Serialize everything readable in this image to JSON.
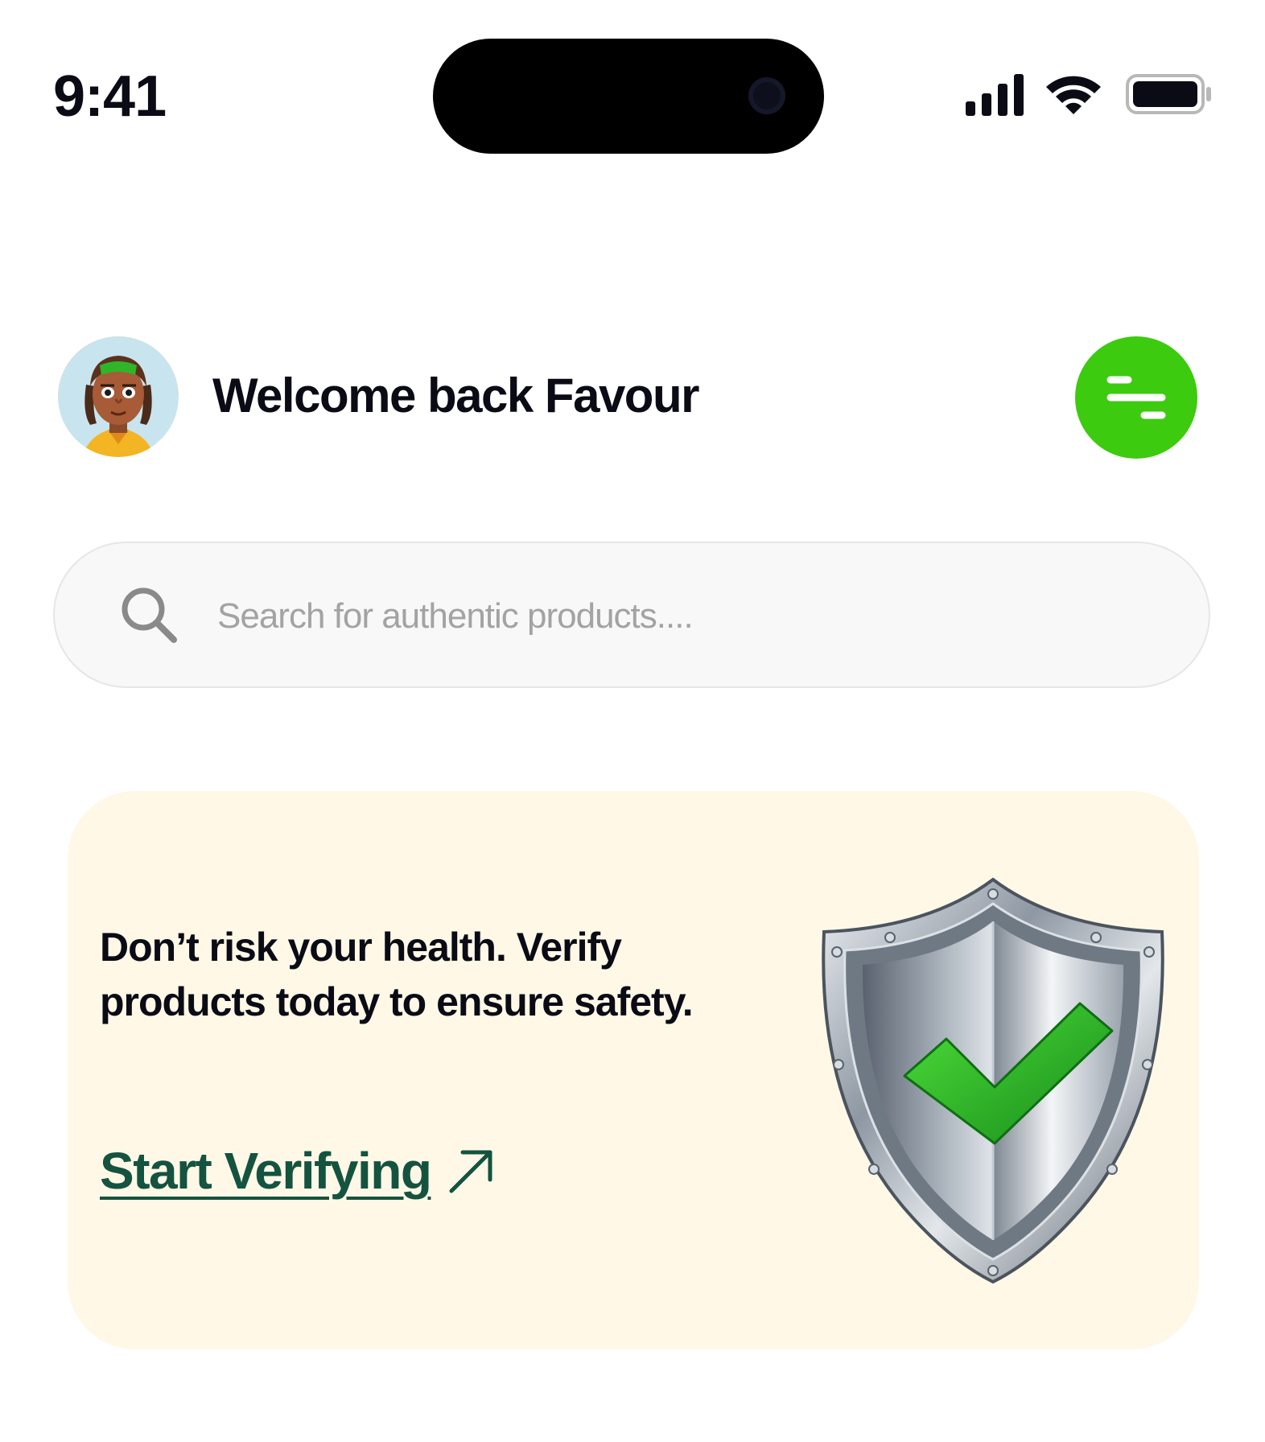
{
  "status_bar": {
    "time": "9:41"
  },
  "header": {
    "welcome_text": "Welcome back Favour"
  },
  "search": {
    "placeholder": "Search for authentic products...."
  },
  "promo": {
    "message": "Don’t risk your health. Verify products today to ensure safety.",
    "cta_label": "Start Verifying"
  },
  "colors": {
    "accent_green": "#3ccb0f",
    "cta_green": "#14533f",
    "card_background": "#fff8e7",
    "search_background": "#f8f8f8"
  },
  "icons": {
    "menu": "menu-lines-icon",
    "search": "search-icon",
    "cta": "arrow-up-right-icon",
    "signal": "cellular-signal-icon",
    "wifi": "wifi-icon",
    "battery": "battery-icon"
  }
}
